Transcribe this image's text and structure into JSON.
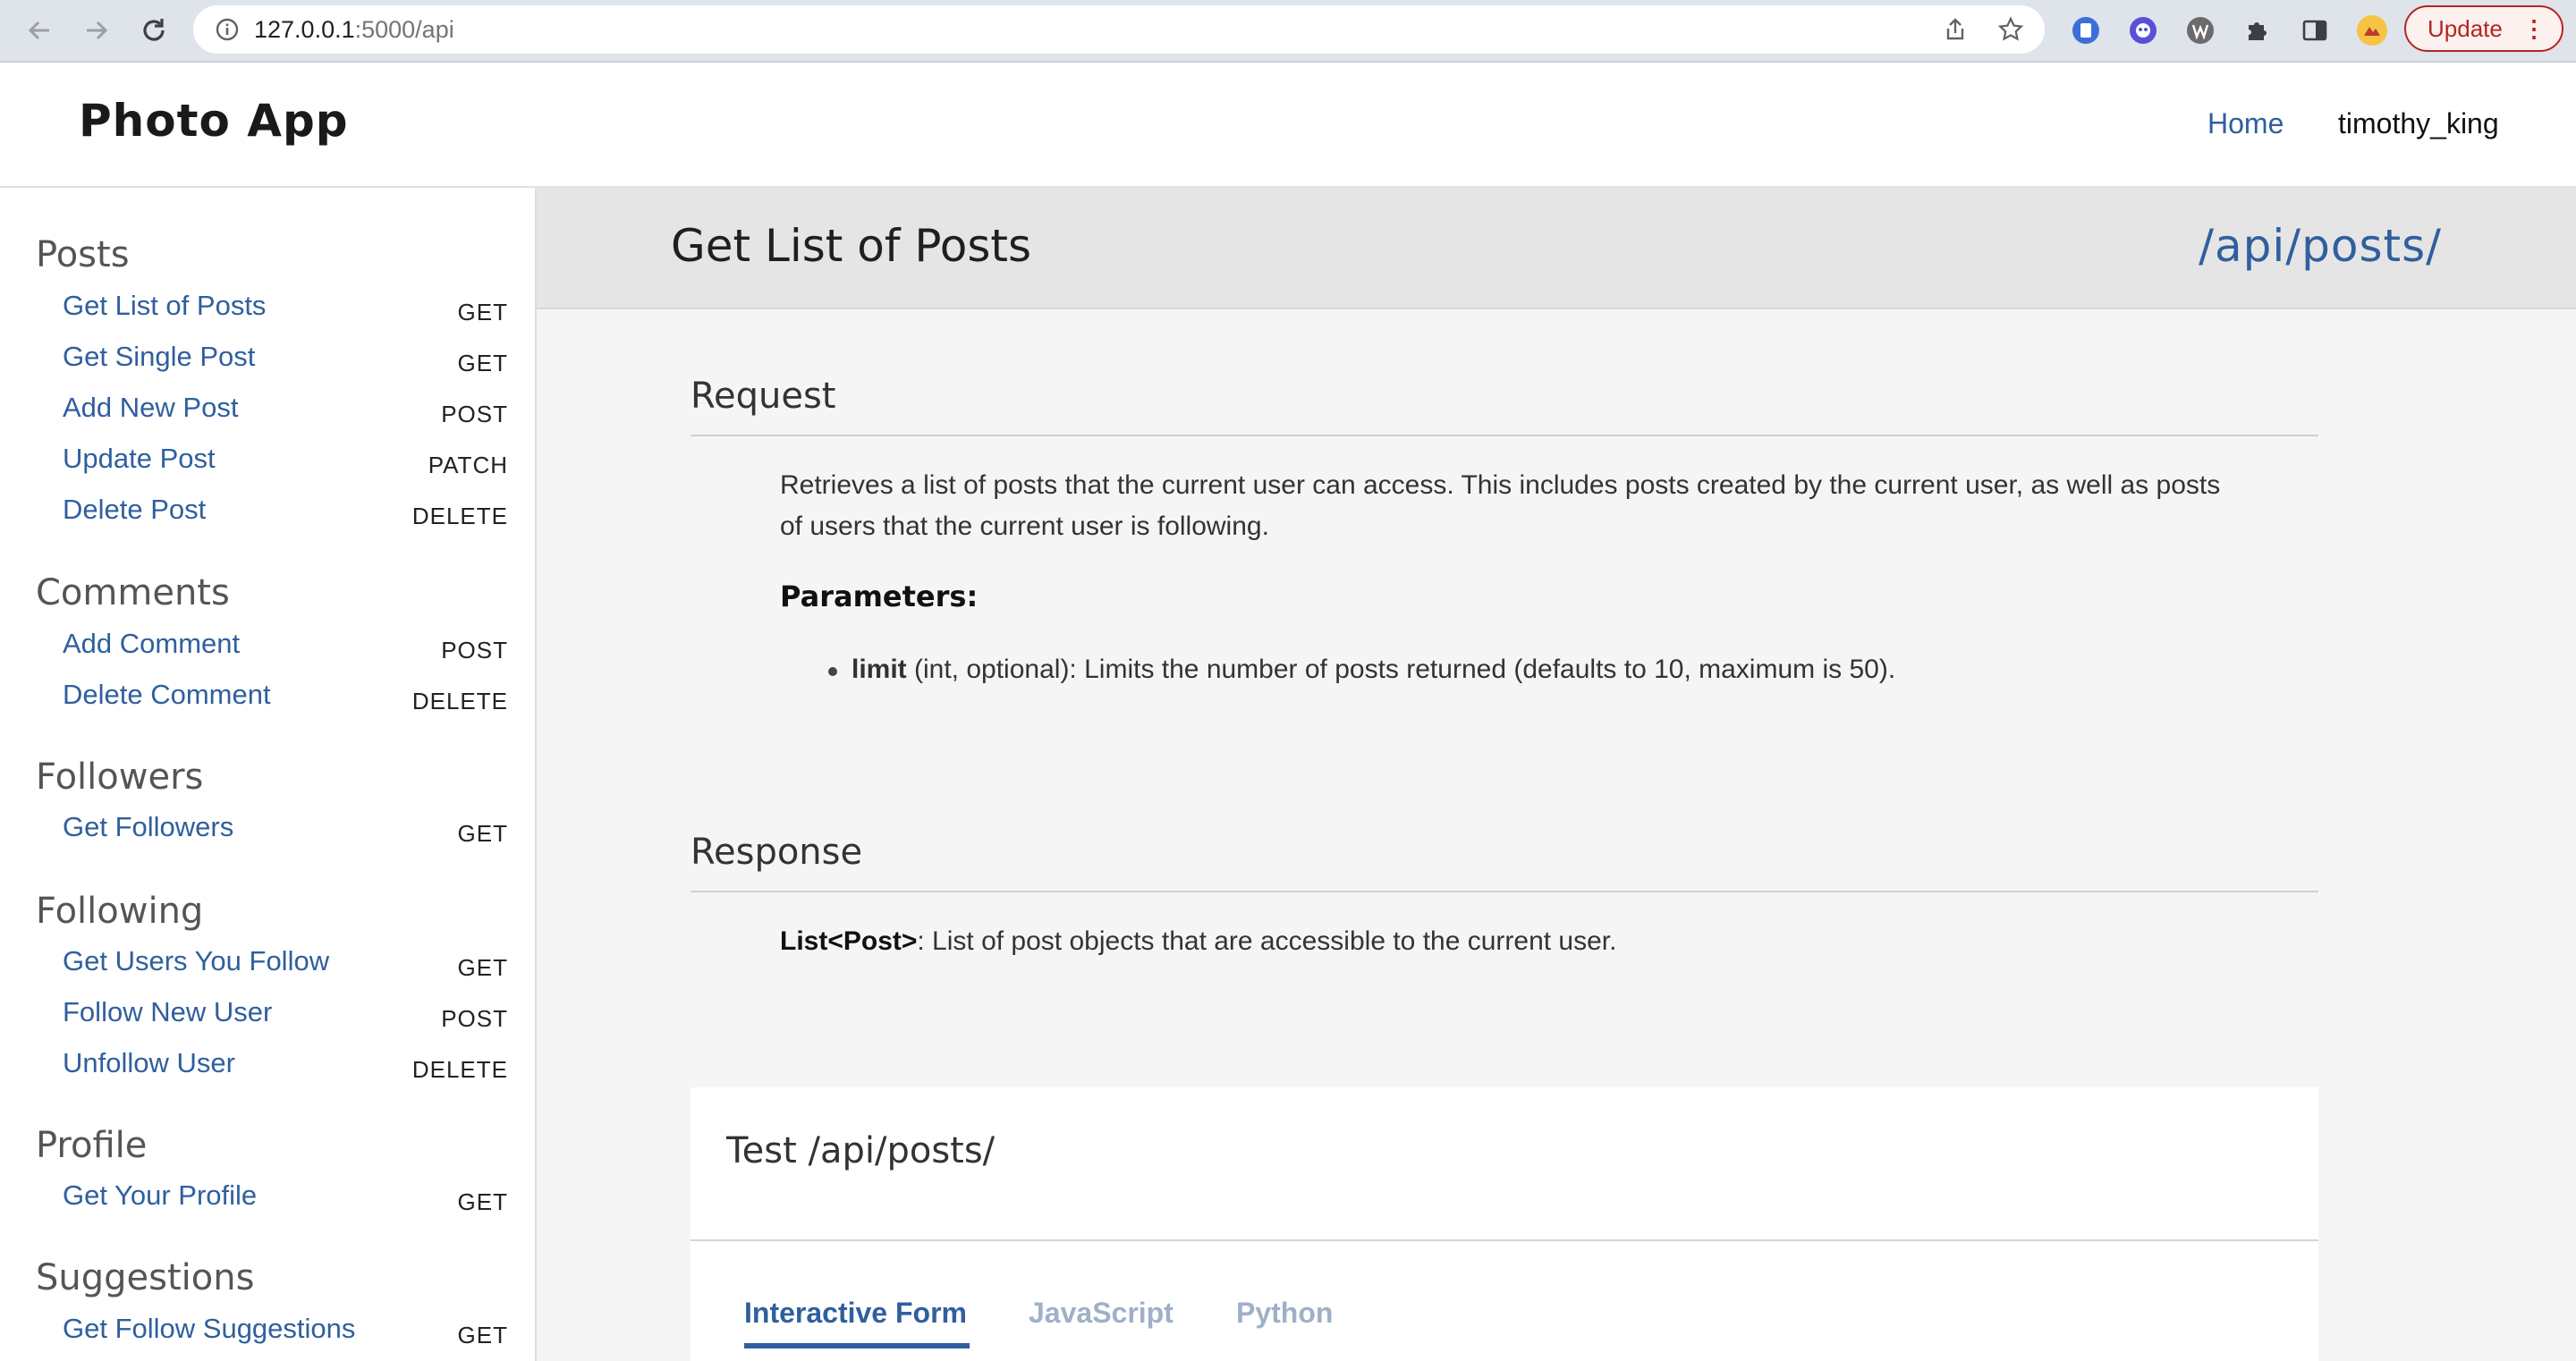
{
  "browser": {
    "url_host": "127.0.0.1",
    "url_rest": ":5000/api",
    "update_label": "Update"
  },
  "header": {
    "app_title": "Photo App",
    "nav_home": "Home",
    "nav_user": "timothy_king"
  },
  "sidebar": {
    "sections": [
      {
        "title": "Posts",
        "items": [
          {
            "label": "Get List of Posts",
            "method": "GET"
          },
          {
            "label": "Get Single Post",
            "method": "GET"
          },
          {
            "label": "Add New Post",
            "method": "POST"
          },
          {
            "label": "Update Post",
            "method": "PATCH"
          },
          {
            "label": "Delete Post",
            "method": "DELETE"
          }
        ]
      },
      {
        "title": "Comments",
        "items": [
          {
            "label": "Add Comment",
            "method": "POST"
          },
          {
            "label": "Delete Comment",
            "method": "DELETE"
          }
        ]
      },
      {
        "title": "Followers",
        "items": [
          {
            "label": "Get Followers",
            "method": "GET"
          }
        ]
      },
      {
        "title": "Following",
        "items": [
          {
            "label": "Get Users You Follow",
            "method": "GET"
          },
          {
            "label": "Follow New User",
            "method": "POST"
          },
          {
            "label": "Unfollow User",
            "method": "DELETE"
          }
        ]
      },
      {
        "title": "Profile",
        "items": [
          {
            "label": "Get Your Profile",
            "method": "GET"
          }
        ]
      },
      {
        "title": "Suggestions",
        "items": [
          {
            "label": "Get Follow Suggestions",
            "method": "GET"
          }
        ]
      }
    ]
  },
  "main": {
    "title": "Get List of Posts",
    "path": "/api/posts/",
    "request": {
      "heading": "Request",
      "description_line1": "Retrieves a list of posts that the current user can access. This includes posts created by the current user, as well as posts",
      "description_line2": "of users that the current user is following.",
      "params_label": "Parameters:",
      "param_name": "limit",
      "param_desc": " (int, optional): Limits the number of posts returned (defaults to 10, maximum is 50)."
    },
    "response": {
      "heading": "Response",
      "type": "List<Post>",
      "desc": ": List of post objects that are accessible to the current user."
    },
    "test": {
      "title": "Test /api/posts/",
      "tabs": [
        "Interactive Form",
        "JavaScript",
        "Python"
      ]
    }
  },
  "colors": {
    "link_blue": "#2f5f9e",
    "tab_inactive": "#9fb0c8",
    "update_red": "#b3261e"
  }
}
